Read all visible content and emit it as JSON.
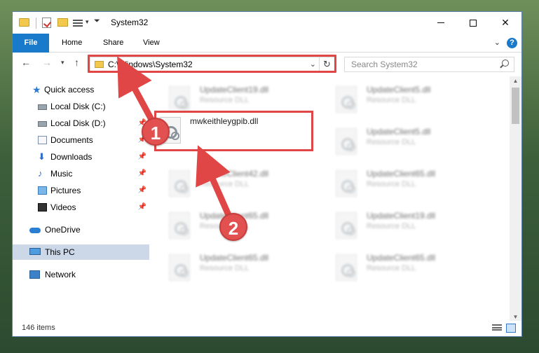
{
  "window": {
    "title": "System32"
  },
  "ribbon": {
    "tabs": [
      "File",
      "Home",
      "Share",
      "View"
    ],
    "help": "?"
  },
  "address": {
    "path": "C:\\Windows\\System32"
  },
  "search": {
    "placeholder": "Search System32"
  },
  "sidebar": {
    "items": [
      {
        "label": "Quick access",
        "icon": "star-icon",
        "pinned": false
      },
      {
        "label": "Local Disk (C:)",
        "icon": "disk-icon",
        "pinned": false
      },
      {
        "label": "Local Disk (D:)",
        "icon": "disk-icon",
        "pinned": true
      },
      {
        "label": "Documents",
        "icon": "documents-icon",
        "pinned": true
      },
      {
        "label": "Downloads",
        "icon": "download-icon",
        "pinned": true
      },
      {
        "label": "Music",
        "icon": "music-icon",
        "pinned": true
      },
      {
        "label": "Pictures",
        "icon": "pictures-icon",
        "pinned": true
      },
      {
        "label": "Videos",
        "icon": "videos-icon",
        "pinned": true
      },
      {
        "label": "OneDrive",
        "icon": "cloud-icon",
        "pinned": false
      },
      {
        "label": "This PC",
        "icon": "computer-icon",
        "pinned": false,
        "selected": true
      },
      {
        "label": "Network",
        "icon": "network-icon",
        "pinned": false
      }
    ]
  },
  "files": [
    {
      "name": "UpdateClient19.dll",
      "type": "Resource DLL"
    },
    {
      "name": "UpdateClient5.dll",
      "type": "Resource DLL"
    },
    {
      "name": "UpdateClient5.dll",
      "type": "Resource DLL"
    },
    {
      "name": "UpdateClient42.dll",
      "type": "Resource DLL"
    },
    {
      "name": "UpdateClient65.dll",
      "type": "Resource DLL"
    },
    {
      "name": "UpdateClient65.dll",
      "type": "Resource DLL"
    },
    {
      "name": "UpdateClient19.dll",
      "type": "Resource DLL"
    },
    {
      "name": "UpdateClient65.dll",
      "type": "Resource DLL"
    },
    {
      "name": "UpdateClient65.dll",
      "type": "Resource DLL"
    }
  ],
  "highlighted_file": {
    "name": "mwkeithleygpib.dll"
  },
  "status": {
    "items_count": "146 items"
  },
  "annotations": {
    "step1": "1",
    "step2": "2",
    "color": "#e04646"
  }
}
